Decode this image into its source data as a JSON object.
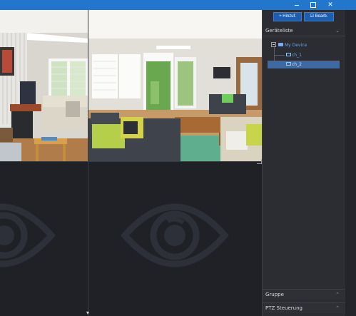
{
  "window": {
    "minimize_icon": "minimize-icon",
    "maximize_icon": "maximize-icon",
    "close_icon": "close-icon"
  },
  "toolbar": {
    "add_label": "+ Hinzuf.",
    "edit_label": "☑ Bearb."
  },
  "panel": {
    "device_list_title": "Geräteliste",
    "group_title": "Gruppe",
    "ptz_title": "PTZ Steuerung"
  },
  "tree": {
    "root": "My Device",
    "channels": [
      "ch_1",
      "ch_2"
    ],
    "selected": "ch_2"
  },
  "video_tiles": [
    {
      "id": "tile-1",
      "state": "live-view"
    },
    {
      "id": "tile-2",
      "state": "live-view"
    },
    {
      "id": "tile-3",
      "state": "no-video",
      "icon": "eye-icon"
    },
    {
      "id": "tile-4",
      "state": "no-video",
      "icon": "eye-icon"
    }
  ],
  "colors": {
    "titlebar": "#2277cc",
    "panel_bg": "#2b2d33",
    "video_bg": "#1f2127",
    "selection": "#3d6aa3",
    "accent_button": "#1e5eb0"
  }
}
